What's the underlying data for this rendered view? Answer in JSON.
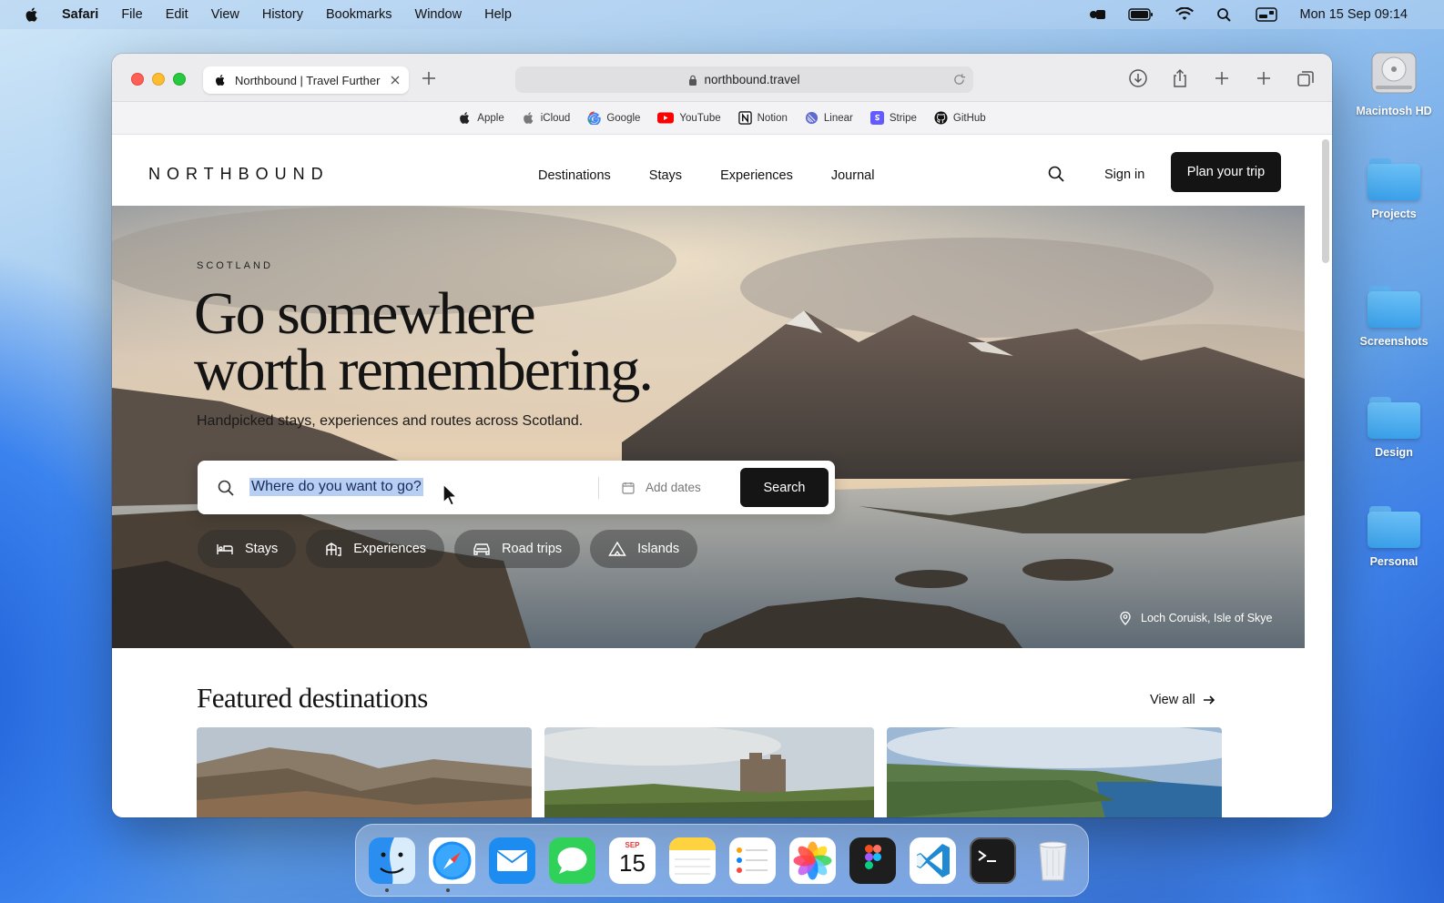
{
  "menubar": {
    "app_name": "Safari",
    "menus": [
      "File",
      "Edit",
      "View",
      "History",
      "Bookmarks",
      "Window",
      "Help"
    ],
    "clock": "Mon 15 Sep  09:14",
    "status_icons": [
      "control-center-icon",
      "battery-icon",
      "wifi-icon",
      "spotlight-icon",
      "display-icon"
    ]
  },
  "desktop": {
    "items": [
      {
        "label": "Macintosh HD",
        "icon": "hard-drive-icon"
      },
      {
        "label": "Projects",
        "icon": "folder-icon"
      },
      {
        "label": "Screenshots",
        "icon": "folder-icon"
      },
      {
        "label": "Design",
        "icon": "folder-icon"
      },
      {
        "label": "Personal",
        "icon": "folder-icon"
      }
    ]
  },
  "browser": {
    "tab_title": "Northbound | Travel Further",
    "url": "northbound.travel",
    "bookmarks": [
      "Apple",
      "iCloud",
      "Google",
      "YouTube",
      "Notion",
      "Linear",
      "Stripe",
      "GitHub"
    ]
  },
  "site": {
    "logo": "NORTHBOUND",
    "nav": [
      "Destinations",
      "Stays",
      "Experiences",
      "Journal"
    ],
    "sign_in": "Sign in",
    "cta": "Plan your trip",
    "hero": {
      "eyebrow": "SCOTLAND",
      "headline_line1": "Go somewhere",
      "headline_line2": "worth remembering.",
      "subhead": "Handpicked stays, experiences and routes across Scotland.",
      "search_value": "Where do you want to go?",
      "dates_placeholder": "Add dates",
      "search_button": "Search",
      "chips": [
        "Stays",
        "Experiences",
        "Road trips",
        "Islands"
      ],
      "caption": "Loch Coruisk, Isle of Skye"
    },
    "featured": {
      "title": "Featured destinations",
      "view_all": "View all"
    }
  },
  "dock": {
    "apps": [
      "Finder",
      "Safari",
      "Mail",
      "Messages",
      "Calendar",
      "Notes",
      "Reminders",
      "Photos",
      "Figma",
      "VS Code",
      "Terminal",
      "Trash"
    ],
    "calendar_month": "SEP",
    "calendar_day": "15"
  }
}
